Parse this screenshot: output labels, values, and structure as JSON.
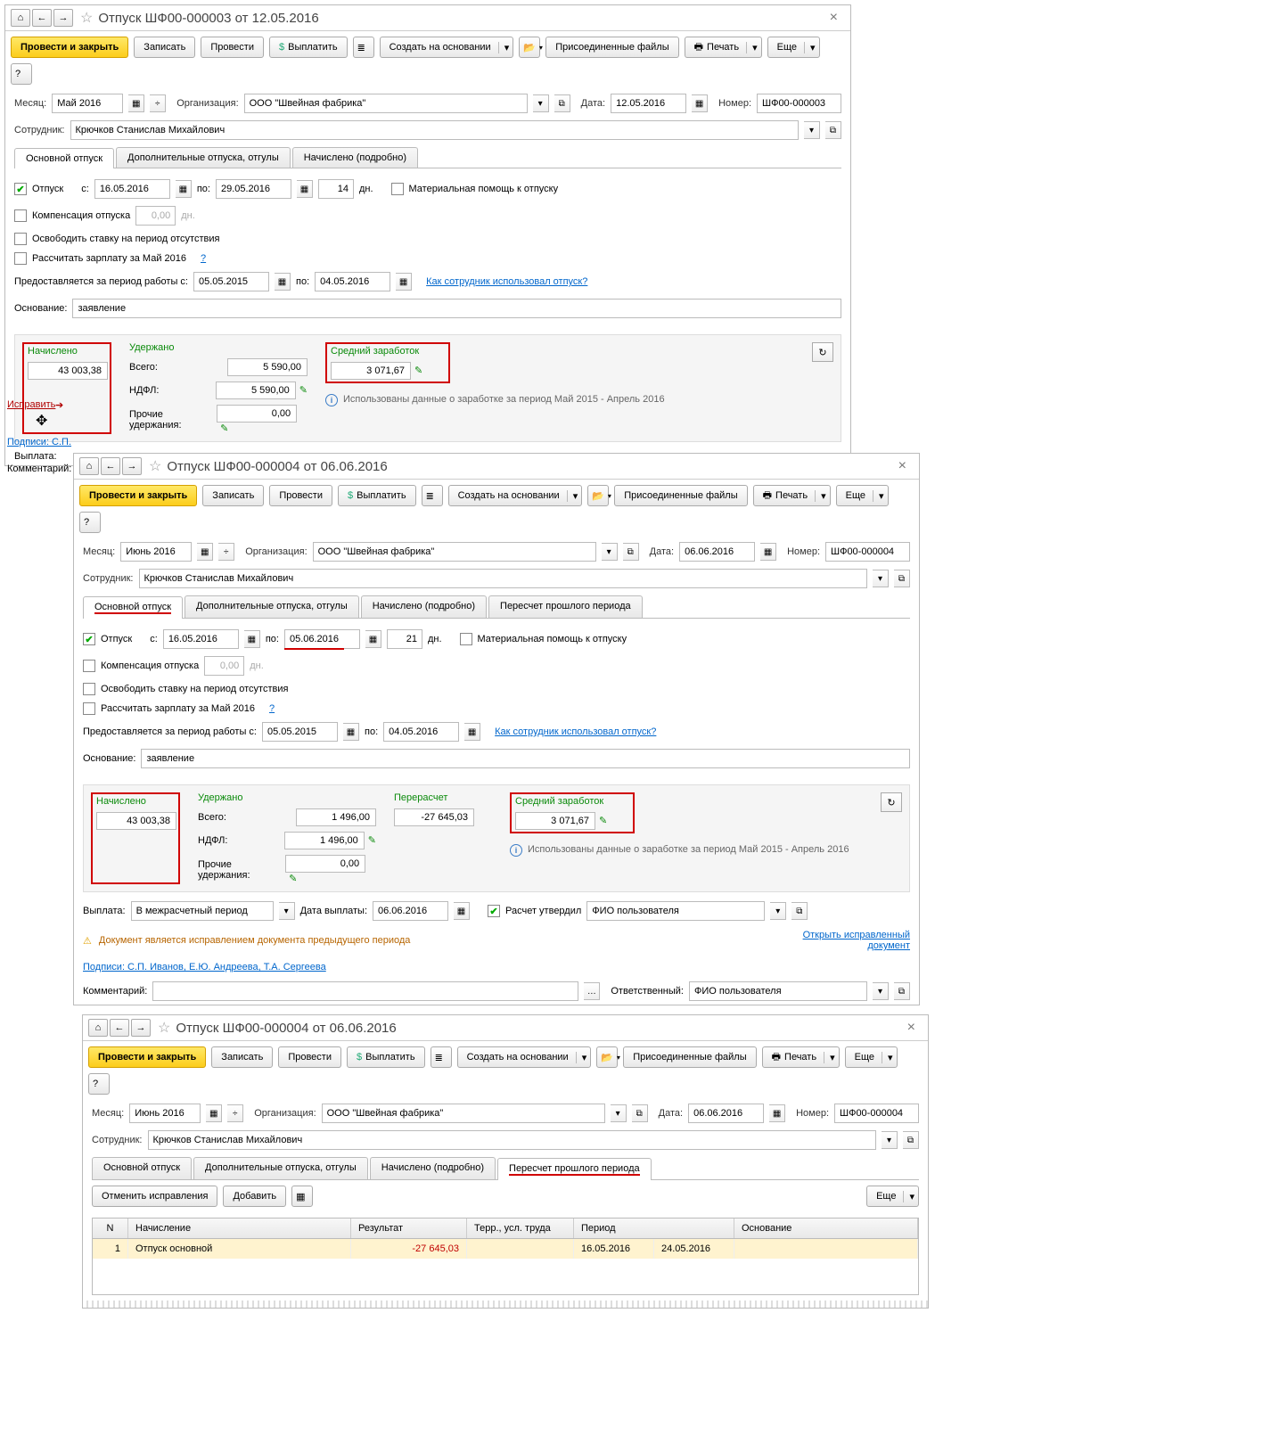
{
  "w1": {
    "title": "Отпуск ШФ00-000003 от 12.05.2016",
    "btn": {
      "post_close": "Провести и закрыть",
      "write": "Записать",
      "post": "Провести",
      "pay": "Выплатить",
      "create_based": "Создать на основании",
      "attached": "Присоединенные файлы",
      "print": "Печать",
      "more": "Еще"
    },
    "month_lbl": "Месяц:",
    "month": "Май 2016",
    "org_lbl": "Организация:",
    "org": "ООО \"Швейная фабрика\"",
    "date_lbl": "Дата:",
    "date": "12.05.2016",
    "num_lbl": "Номер:",
    "num": "ШФ00-000003",
    "emp_lbl": "Сотрудник:",
    "emp": "Крючков Станислав Михайлович",
    "tabs": [
      "Основной отпуск",
      "Дополнительные отпуска, отгулы",
      "Начислено (подробно)"
    ],
    "vac_lbl": "Отпуск",
    "from_lbl": "с:",
    "from": "16.05.2016",
    "to_lbl": "по:",
    "to": "29.05.2016",
    "days": "14",
    "days_lbl": "дн.",
    "mat_aid": "Материальная помощь к отпуску",
    "comp_lbl": "Компенсация отпуска",
    "comp_days": "0,00",
    "free_rate": "Освободить ставку на период отсутствия",
    "calc_sal": "Рассчитать зарплату за Май 2016",
    "period_lbl": "Предоставляется за период работы с:",
    "p_from": "05.05.2015",
    "p_to": "04.05.2016",
    "how_link": "Как сотрудник использовал отпуск?",
    "basis_lbl": "Основание:",
    "basis": "заявление",
    "accrued_lbl": "Начислено",
    "accrued": "43 003,38",
    "withheld_lbl": "Удержано",
    "total_lbl": "Всего:",
    "total": "5 590,00",
    "ndfl_lbl": "НДФЛ:",
    "ndfl": "5 590,00",
    "other_lbl": "Прочие удержания:",
    "other": "0,00",
    "avg_lbl": "Средний заработок",
    "avg": "3 071,67",
    "avg_info": "Использованы данные о заработке за период Май 2015 - Апрель 2016",
    "payout_lbl": "Выплата:"
  },
  "fix_link": "Исправить",
  "sign_link1": "Подписи: С.П.",
  "comment_lbl1": "Комментарий:",
  "w2": {
    "title": "Отпуск ШФ00-000004 от 06.06.2016",
    "btn": {
      "post_close": "Провести и закрыть",
      "write": "Записать",
      "post": "Провести",
      "pay": "Выплатить",
      "create_based": "Создать на основании",
      "attached": "Присоединенные файлы",
      "print": "Печать",
      "more": "Еще"
    },
    "month_lbl": "Месяц:",
    "month": "Июнь 2016",
    "org_lbl": "Организация:",
    "org": "ООО \"Швейная фабрика\"",
    "date_lbl": "Дата:",
    "date": "06.06.2016",
    "num_lbl": "Номер:",
    "num": "ШФ00-000004",
    "emp_lbl": "Сотрудник:",
    "emp": "Крючков Станислав Михайлович",
    "tabs": [
      "Основной отпуск",
      "Дополнительные отпуска, отгулы",
      "Начислено (подробно)",
      "Пересчет прошлого периода"
    ],
    "vac_lbl": "Отпуск",
    "from_lbl": "с:",
    "from": "16.05.2016",
    "to_lbl": "по:",
    "to": "05.06.2016",
    "days": "21",
    "days_lbl": "дн.",
    "mat_aid": "Материальная помощь к отпуску",
    "comp_lbl": "Компенсация отпуска",
    "comp_days": "0,00",
    "free_rate": "Освободить ставку на период отсутствия",
    "calc_sal": "Рассчитать зарплату за Май 2016",
    "period_lbl": "Предоставляется за период работы с:",
    "p_from": "05.05.2015",
    "p_to": "04.05.2016",
    "how_link": "Как сотрудник использовал отпуск?",
    "basis_lbl": "Основание:",
    "basis": "заявление",
    "accrued_lbl": "Начислено",
    "accrued": "43 003,38",
    "withheld_lbl": "Удержано",
    "total_lbl": "Всего:",
    "total": "1 496,00",
    "ndfl_lbl": "НДФЛ:",
    "ndfl": "1 496,00",
    "other_lbl": "Прочие удержания:",
    "other": "0,00",
    "recalc_lbl": "Перерасчет",
    "recalc": "-27 645,03",
    "avg_lbl": "Средний заработок",
    "avg": "3 071,67",
    "avg_info": "Использованы данные о заработке за период Май 2015 - Апрель 2016",
    "payout_lbl": "Выплата:",
    "payout_mode": "В межрасчетный период",
    "paydate_lbl": "Дата выплаты:",
    "paydate": "06.06.2016",
    "approved_lbl": "Расчет утвердил",
    "approved_by": "ФИО пользователя",
    "warn": "Документ является исправлением документа предыдущего периода",
    "open_fixed": "Открыть исправленный документ",
    "sign": "Подписи: С.П. Иванов, Е.Ю. Андреева, Т.А. Сергеева",
    "comment_lbl": "Комментарий:",
    "resp_lbl": "Ответственный:",
    "resp": "ФИО пользователя"
  },
  "w3": {
    "title": "Отпуск ШФ00-000004 от 06.06.2016",
    "btn": {
      "post_close": "Провести и закрыть",
      "write": "Записать",
      "post": "Провести",
      "pay": "Выплатить",
      "create_based": "Создать на основании",
      "attached": "Присоединенные файлы",
      "print": "Печать",
      "more": "Еще",
      "cancel_fix": "Отменить исправления",
      "add": "Добавить"
    },
    "month_lbl": "Месяц:",
    "month": "Июнь 2016",
    "org_lbl": "Организация:",
    "org": "ООО \"Швейная фабрика\"",
    "date_lbl": "Дата:",
    "date": "06.06.2016",
    "num_lbl": "Номер:",
    "num": "ШФ00-000004",
    "emp_lbl": "Сотрудник:",
    "emp": "Крючков Станислав Михайлович",
    "tabs": [
      "Основной отпуск",
      "Дополнительные отпуска, отгулы",
      "Начислено (подробно)",
      "Пересчет прошлого периода"
    ],
    "grid_hdr": {
      "n": "N",
      "accrual": "Начисление",
      "result": "Результат",
      "terr": "Терр., усл. труда",
      "period": "Период",
      "basis": "Основание"
    },
    "grid_row": {
      "n": "1",
      "accrual": "Отпуск основной",
      "result": "-27 645,03",
      "p1": "16.05.2016",
      "p2": "24.05.2016"
    }
  }
}
